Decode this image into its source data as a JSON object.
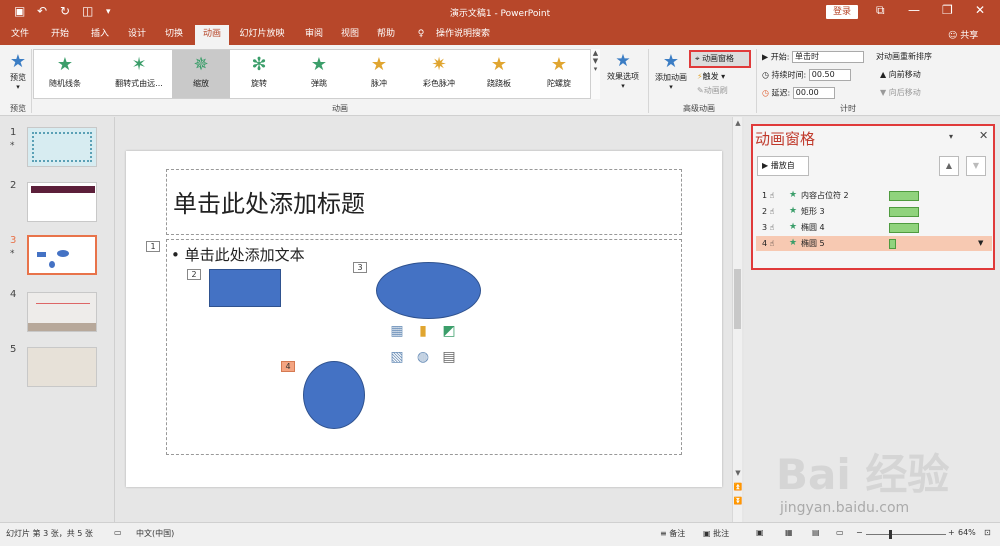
{
  "window": {
    "title": "演示文稿1 - PowerPoint",
    "login_label": "登录",
    "share_label": "共享"
  },
  "tabs": [
    {
      "label": "文件"
    },
    {
      "label": "开始"
    },
    {
      "label": "插入"
    },
    {
      "label": "设计"
    },
    {
      "label": "切换"
    },
    {
      "label": "动画"
    },
    {
      "label": "幻灯片放映"
    },
    {
      "label": "审阅"
    },
    {
      "label": "视图"
    },
    {
      "label": "帮助"
    },
    {
      "label": "操作说明搜索"
    }
  ],
  "ribbon": {
    "preview_label": "预览",
    "preview_group": "预览",
    "animations_group": "动画",
    "advanced_group": "高级动画",
    "timing_group": "计时",
    "gallery": [
      {
        "label": "随机线条",
        "icon": "star-icon"
      },
      {
        "label": "翻转式由远...",
        "icon": "star-icon"
      },
      {
        "label": "缩放",
        "icon": "star-icon",
        "selected": true
      },
      {
        "label": "旋转",
        "icon": "star-icon"
      },
      {
        "label": "弹跳",
        "icon": "star-icon"
      },
      {
        "label": "脉冲",
        "icon": "star-icon"
      },
      {
        "label": "彩色脉冲",
        "icon": "star-icon"
      },
      {
        "label": "跷跷板",
        "icon": "star-icon"
      },
      {
        "label": "陀螺旋",
        "icon": "star-icon"
      }
    ],
    "effect_options_label": "效果选项",
    "add_animation_label": "添加动画",
    "animation_pane_label": "动画窗格",
    "trigger_label": "触发",
    "animation_brush_label": "动画刷",
    "start_label": "开始:",
    "start_value": "单击时",
    "duration_label": "持续时间:",
    "duration_value": "00.50",
    "delay_label": "延迟:",
    "delay_value": "00.00",
    "reorder_label": "对动画重新排序",
    "move_earlier_label": "向前移动",
    "move_later_label": "向后移动"
  },
  "thumbnails": [
    {
      "num": "1",
      "star": true
    },
    {
      "num": "2",
      "star": false
    },
    {
      "num": "3",
      "star": true,
      "selected": true
    },
    {
      "num": "4",
      "star": false
    },
    {
      "num": "5",
      "star": false
    }
  ],
  "slide": {
    "title_placeholder": "单击此处添加标题",
    "body_placeholder": "单击此处添加文本",
    "tags": [
      "1",
      "2",
      "3",
      "4"
    ]
  },
  "animation_pane": {
    "title": "动画窗格",
    "play_label": "播放自",
    "items": [
      {
        "num": "1",
        "name": "内容占位符 2",
        "duration_fraction": 1.0
      },
      {
        "num": "2",
        "name": "矩形 3",
        "duration_fraction": 1.0
      },
      {
        "num": "3",
        "name": "椭圆 4",
        "duration_fraction": 1.0
      },
      {
        "num": "4",
        "name": "椭圆 5",
        "duration_fraction": 0.23,
        "selected": true
      }
    ]
  },
  "status": {
    "slide_info": "幻灯片 第 3 张，共 5 张",
    "language": "中文(中国)",
    "notes_label": "备注",
    "comments_label": "批注",
    "zoom": "64%"
  },
  "watermark": {
    "text": "Bai 经验",
    "url": "jingyan.baidu.com"
  }
}
